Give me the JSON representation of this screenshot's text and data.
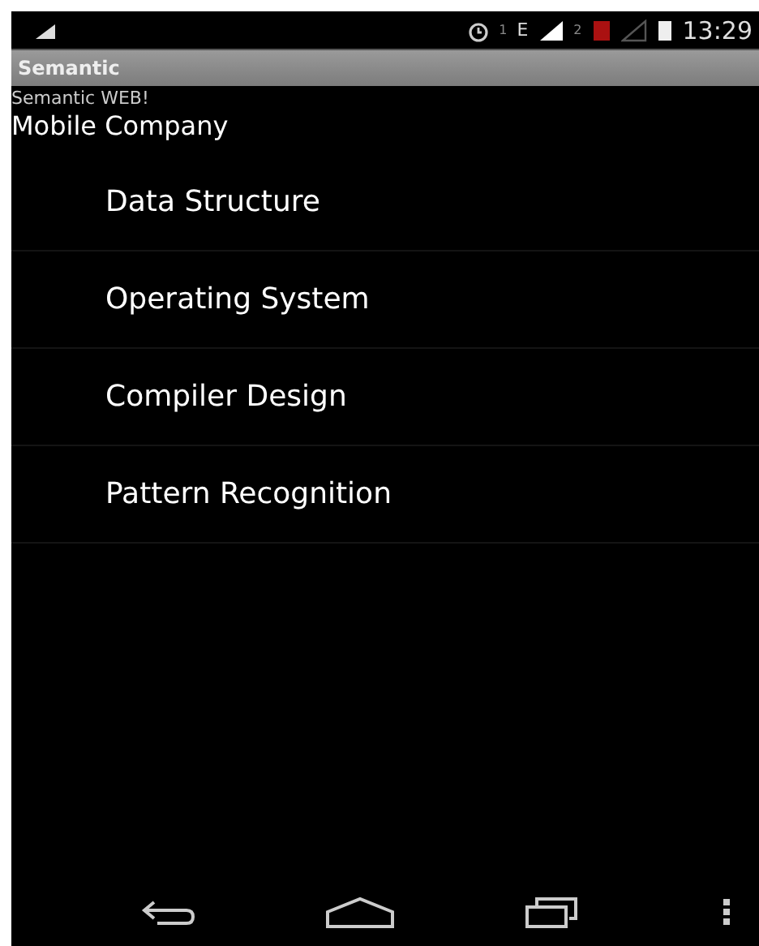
{
  "status_bar": {
    "sim1_label": "1",
    "network_type": "E",
    "sim2_label": "2",
    "time": "13:29"
  },
  "action_bar": {
    "title": "Semantic"
  },
  "header": {
    "subtitle": "Semantic WEB!",
    "heading": "Mobile Company"
  },
  "list": {
    "items": [
      {
        "label": "Data Structure"
      },
      {
        "label": "Operating System"
      },
      {
        "label": "Compiler Design"
      },
      {
        "label": "Pattern Recognition"
      }
    ]
  }
}
